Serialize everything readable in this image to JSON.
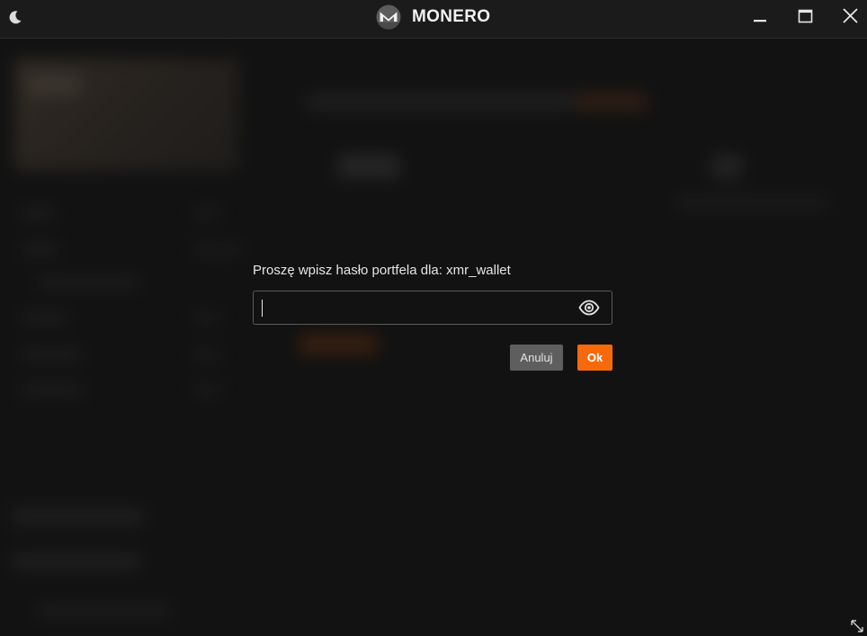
{
  "window": {
    "app_name": "MONERO",
    "colors": {
      "accent": "#f76a0b",
      "background": "#161616",
      "titlebar": "#1b1b1b",
      "cancel_button": "#5e5e5e"
    },
    "icons": {
      "theme_toggle": "moon-icon",
      "logo": "monero-logo",
      "minimize": "minimize-icon",
      "maximize": "maximize-icon",
      "close": "close-icon",
      "resize": "resize-icon"
    }
  },
  "password_dialog": {
    "prompt": "Proszę wpisz hasło portfela dla: xmr_wallet",
    "password_value": "",
    "password_placeholder": "",
    "show_password_icon": "eye-icon",
    "cancel_label": "Anuluj",
    "ok_label": "Ok"
  }
}
